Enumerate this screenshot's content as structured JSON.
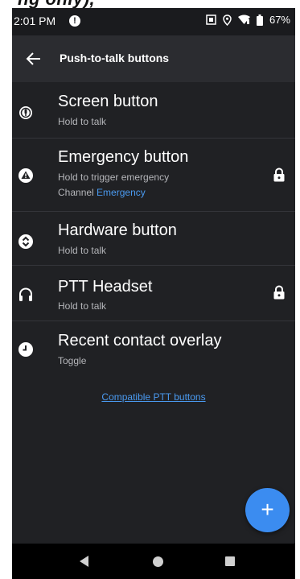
{
  "header_crop_text": "ng only),",
  "status_bar": {
    "time": "2:01 PM",
    "battery": "67%"
  },
  "app_bar": {
    "title": "Push-to-talk buttons"
  },
  "items": [
    {
      "title": "Screen button",
      "subtitle": "Hold to talk",
      "icon": "mic-circle-icon",
      "locked": false
    },
    {
      "title": "Emergency button",
      "subtitle": "Hold to trigger emergency",
      "channel_label": "Channel",
      "channel_value": "Emergency",
      "icon": "warning-icon",
      "locked": true
    },
    {
      "title": "Hardware button",
      "subtitle": "Hold to talk",
      "icon": "up-down-circle-icon",
      "locked": false
    },
    {
      "title": "PTT Headset",
      "subtitle": "Hold to talk",
      "icon": "headset-icon",
      "locked": true
    },
    {
      "title": "Recent contact overlay",
      "subtitle": "Toggle",
      "icon": "clock-icon",
      "locked": false
    }
  ],
  "compatible_link": "Compatible PTT buttons",
  "fab_label": "+",
  "colors": {
    "background": "#202124",
    "app_bar": "#2b2c30",
    "accent": "#3b8cf0",
    "link": "#4a9af0"
  }
}
